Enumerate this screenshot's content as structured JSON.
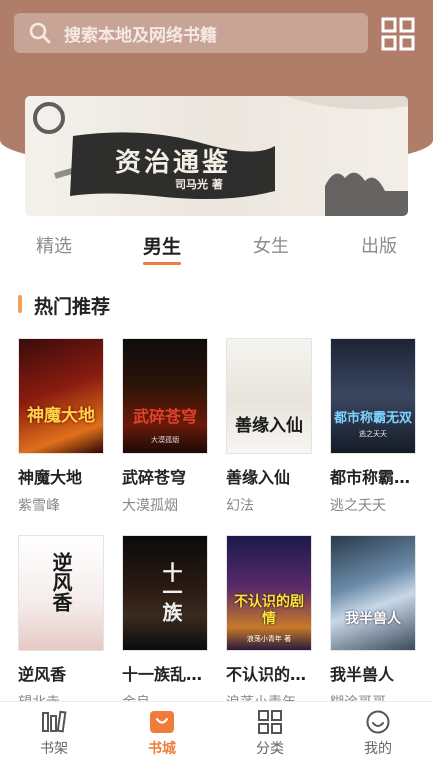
{
  "search": {
    "placeholder": "搜索本地及网络书籍",
    "icon": "search-icon"
  },
  "header": {
    "grid_icon": "grid-icon",
    "bg_color": "#b07d69"
  },
  "banner": {
    "title": "资治通鉴",
    "author": "司马光 著"
  },
  "tabs": [
    {
      "label": "精选",
      "active": false
    },
    {
      "label": "男生",
      "active": true
    },
    {
      "label": "女生",
      "active": false
    },
    {
      "label": "出版",
      "active": false
    }
  ],
  "section": {
    "title": "热门推荐"
  },
  "books": [
    {
      "title": "神魔大地",
      "author": "紫雪峰",
      "cover_text": "神魔大地"
    },
    {
      "title": "武碎苍穹",
      "author": "大漠孤烟",
      "cover_text": "武碎苍穹",
      "cover_sub": "大漠孤烟"
    },
    {
      "title": "善缘入仙",
      "author": "幻法",
      "cover_text": "善缘入仙"
    },
    {
      "title": "都市称霸…",
      "author": "逃之夭夭",
      "cover_text": "都市称霸无双",
      "cover_sub": "逃之夭夭"
    },
    {
      "title": "逆风香",
      "author": "望北寺",
      "cover_text": "逆风香"
    },
    {
      "title": "十一族乱…",
      "author": "金良",
      "cover_text": "十一族"
    },
    {
      "title": "不认识的…",
      "author": "浪荡小青年",
      "cover_text": "不认识的剧情",
      "cover_sub": "浪荡小青年 著"
    },
    {
      "title": "我半兽人",
      "author": "糊涂哥哥",
      "cover_text": "我半兽人"
    }
  ],
  "bottom_nav": [
    {
      "label": "书架",
      "icon": "bookshelf-icon",
      "active": false
    },
    {
      "label": "书城",
      "icon": "bookstore-icon",
      "active": true
    },
    {
      "label": "分类",
      "icon": "category-icon",
      "active": false
    },
    {
      "label": "我的",
      "icon": "smile-icon",
      "active": false
    }
  ],
  "colors": {
    "accent": "#f07b3a",
    "section_bar": "#f2a15b"
  }
}
